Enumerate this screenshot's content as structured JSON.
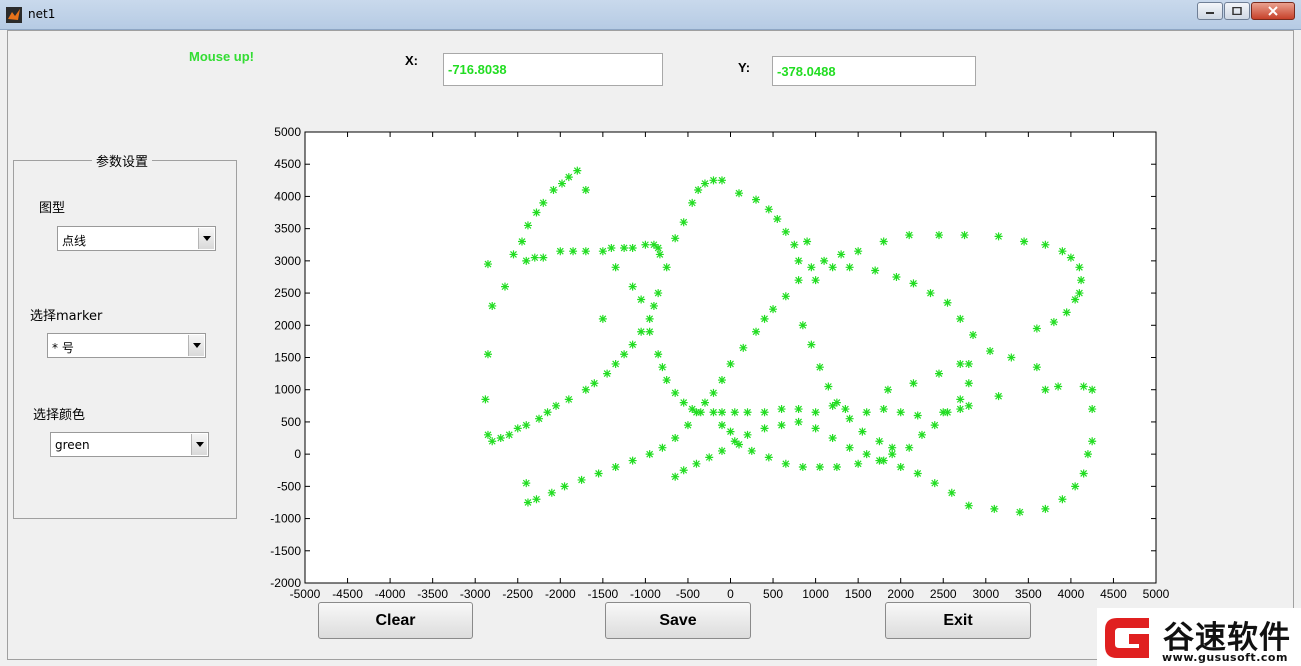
{
  "window": {
    "title": "net1"
  },
  "status_text": "Mouse up!",
  "coords": {
    "x_label": "X:",
    "x_value": "-716.8038",
    "y_label": "Y:",
    "y_value": "-378.0488"
  },
  "panel": {
    "title": "参数设置",
    "plot_type_label": "图型",
    "plot_type_value": "点线",
    "marker_label": "选择marker",
    "marker_value": "* 号",
    "color_label": "选择颜色",
    "color_value": "green"
  },
  "buttons": {
    "clear": "Clear",
    "save": "Save",
    "exit": "Exit"
  },
  "watermark": {
    "name": "谷速软件",
    "url": "www.gususoft.com"
  },
  "colors": {
    "marker": "#22dd22",
    "status": "#33dd33",
    "logo_red": "#e02020"
  },
  "chart_data": {
    "type": "scatter",
    "xlim": [
      -5000,
      5000
    ],
    "ylim": [
      -2000,
      5000
    ],
    "xticks": [
      -5000,
      -4500,
      -4000,
      -3500,
      -3000,
      -2500,
      -2000,
      -1500,
      -1000,
      -500,
      0,
      500,
      1000,
      1500,
      2000,
      2500,
      3000,
      3500,
      4000,
      4500,
      5000
    ],
    "yticks": [
      -2000,
      -1500,
      -1000,
      -500,
      0,
      500,
      1000,
      1500,
      2000,
      2500,
      3000,
      3500,
      4000,
      4500,
      5000
    ],
    "grid": false,
    "marker": "*",
    "marker_color": "#22dd22",
    "strokes": [
      [
        [
          -2850,
          2950
        ],
        [
          -2800,
          2300
        ],
        [
          -2650,
          2600
        ],
        [
          -2550,
          3100
        ],
        [
          -2450,
          3300
        ],
        [
          -2380,
          3550
        ],
        [
          -2280,
          3750
        ],
        [
          -2200,
          3900
        ],
        [
          -2080,
          4100
        ],
        [
          -1980,
          4200
        ],
        [
          -1900,
          4300
        ],
        [
          -1800,
          4400
        ],
        [
          -1700,
          4100
        ]
      ],
      [
        [
          -2400,
          3000
        ],
        [
          -2300,
          3050
        ],
        [
          -2200,
          3050
        ],
        [
          -2000,
          3150
        ],
        [
          -1850,
          3150
        ],
        [
          -1700,
          3150
        ],
        [
          -1500,
          3150
        ],
        [
          -1400,
          3200
        ],
        [
          -1250,
          3200
        ],
        [
          -1150,
          3200
        ],
        [
          -1000,
          3250
        ],
        [
          -900,
          3250
        ],
        [
          -850,
          3200
        ],
        [
          -830,
          3100
        ]
      ],
      [
        [
          -2850,
          1550
        ],
        [
          -2880,
          850
        ],
        [
          -2850,
          300
        ],
        [
          -2800,
          200
        ],
        [
          -2700,
          250
        ],
        [
          -2600,
          300
        ],
        [
          -2500,
          400
        ],
        [
          -2400,
          450
        ],
        [
          -2250,
          550
        ],
        [
          -2150,
          650
        ],
        [
          -2050,
          750
        ],
        [
          -1900,
          850
        ],
        [
          -1700,
          1000
        ],
        [
          -1600,
          1100
        ],
        [
          -1450,
          1250
        ],
        [
          -1350,
          1400
        ],
        [
          -1250,
          1550
        ],
        [
          -1150,
          1700
        ],
        [
          -1050,
          1900
        ],
        [
          -950,
          2100
        ],
        [
          -900,
          2300
        ],
        [
          -850,
          2500
        ],
        [
          -750,
          2900
        ],
        [
          -650,
          3350
        ],
        [
          -550,
          3600
        ],
        [
          -450,
          3900
        ],
        [
          -380,
          4100
        ],
        [
          -300,
          4200
        ],
        [
          -200,
          4250
        ],
        [
          -100,
          4250
        ],
        [
          100,
          4050
        ],
        [
          300,
          3950
        ],
        [
          450,
          3800
        ],
        [
          550,
          3650
        ],
        [
          650,
          3450
        ],
        [
          750,
          3250
        ],
        [
          800,
          3000
        ]
      ],
      [
        [
          -1500,
          2100
        ],
        [
          -1350,
          2900
        ],
        [
          -1150,
          2600
        ],
        [
          -1050,
          2400
        ],
        [
          -950,
          1900
        ],
        [
          -850,
          1550
        ],
        [
          -800,
          1350
        ],
        [
          -750,
          1150
        ],
        [
          -650,
          950
        ],
        [
          -550,
          800
        ],
        [
          -450,
          700
        ],
        [
          -350,
          650
        ],
        [
          -200,
          650
        ],
        [
          -100,
          650
        ],
        [
          50,
          650
        ],
        [
          200,
          650
        ],
        [
          400,
          650
        ],
        [
          600,
          700
        ],
        [
          800,
          700
        ],
        [
          1000,
          650
        ],
        [
          1200,
          750
        ],
        [
          1350,
          700
        ],
        [
          1600,
          650
        ],
        [
          1800,
          700
        ],
        [
          2000,
          650
        ],
        [
          2200,
          600
        ],
        [
          2500,
          650
        ],
        [
          2700,
          700
        ],
        [
          2800,
          750
        ]
      ],
      [
        [
          -2400,
          -450
        ],
        [
          -2380,
          -750
        ],
        [
          -2280,
          -700
        ],
        [
          -2100,
          -600
        ],
        [
          -1950,
          -500
        ],
        [
          -1750,
          -400
        ],
        [
          -1550,
          -300
        ],
        [
          -1350,
          -200
        ],
        [
          -1150,
          -100
        ],
        [
          -950,
          0
        ],
        [
          -800,
          100
        ],
        [
          -650,
          250
        ],
        [
          -500,
          450
        ],
        [
          -400,
          650
        ],
        [
          -300,
          800
        ],
        [
          -200,
          950
        ],
        [
          -100,
          1150
        ],
        [
          0,
          1400
        ],
        [
          150,
          1650
        ],
        [
          300,
          1900
        ],
        [
          400,
          2100
        ],
        [
          500,
          2250
        ],
        [
          650,
          2450
        ],
        [
          800,
          2700
        ],
        [
          950,
          2900
        ],
        [
          1100,
          3000
        ],
        [
          1300,
          3100
        ],
        [
          1500,
          3150
        ],
        [
          1800,
          3300
        ],
        [
          2100,
          3400
        ],
        [
          2450,
          3400
        ],
        [
          2750,
          3400
        ],
        [
          3150,
          3380
        ],
        [
          3450,
          3300
        ],
        [
          3700,
          3250
        ],
        [
          3900,
          3150
        ],
        [
          4000,
          3050
        ],
        [
          4100,
          2900
        ],
        [
          4120,
          2700
        ],
        [
          4100,
          2500
        ],
        [
          4050,
          2400
        ],
        [
          3950,
          2200
        ],
        [
          3800,
          2050
        ],
        [
          3600,
          1950
        ]
      ],
      [
        [
          -650,
          -350
        ],
        [
          -550,
          -250
        ],
        [
          -400,
          -150
        ],
        [
          -250,
          -50
        ],
        [
          -100,
          50
        ],
        [
          50,
          200
        ],
        [
          200,
          300
        ],
        [
          400,
          400
        ],
        [
          600,
          450
        ],
        [
          800,
          500
        ],
        [
          1000,
          400
        ],
        [
          1200,
          250
        ],
        [
          1400,
          100
        ],
        [
          1600,
          0
        ],
        [
          1800,
          -100
        ],
        [
          2000,
          -200
        ],
        [
          2200,
          -300
        ],
        [
          2400,
          -450
        ],
        [
          2600,
          -600
        ],
        [
          2800,
          -800
        ],
        [
          3100,
          -850
        ],
        [
          3400,
          -900
        ],
        [
          3700,
          -850
        ],
        [
          3900,
          -700
        ],
        [
          4050,
          -500
        ],
        [
          4150,
          -300
        ],
        [
          4200,
          0
        ],
        [
          4250,
          200
        ],
        [
          4250,
          700
        ],
        [
          4250,
          1000
        ],
        [
          4150,
          1050
        ],
        [
          3850,
          1050
        ],
        [
          3700,
          1000
        ]
      ],
      [
        [
          -100,
          450
        ],
        [
          0,
          350
        ],
        [
          100,
          150
        ],
        [
          250,
          50
        ],
        [
          450,
          -50
        ],
        [
          650,
          -150
        ],
        [
          850,
          -200
        ],
        [
          1050,
          -200
        ],
        [
          1250,
          -200
        ],
        [
          1500,
          -150
        ],
        [
          1750,
          -100
        ],
        [
          1900,
          0
        ],
        [
          2100,
          100
        ],
        [
          2250,
          300
        ],
        [
          2400,
          450
        ],
        [
          2550,
          650
        ],
        [
          2700,
          850
        ],
        [
          2800,
          1100
        ],
        [
          2800,
          1400
        ]
      ],
      [
        [
          900,
          3300
        ],
        [
          850,
          2000
        ],
        [
          950,
          1700
        ],
        [
          1050,
          1350
        ],
        [
          1150,
          1050
        ],
        [
          1250,
          800
        ],
        [
          1400,
          550
        ],
        [
          1550,
          350
        ],
        [
          1750,
          200
        ],
        [
          1900,
          100
        ]
      ],
      [
        [
          1000,
          2700
        ],
        [
          1200,
          2900
        ],
        [
          1400,
          2900
        ],
        [
          1700,
          2850
        ],
        [
          1950,
          2750
        ],
        [
          2150,
          2650
        ],
        [
          2350,
          2500
        ],
        [
          2550,
          2350
        ],
        [
          2700,
          2100
        ],
        [
          2850,
          1850
        ],
        [
          3050,
          1600
        ],
        [
          3300,
          1500
        ],
        [
          3600,
          1350
        ]
      ],
      [
        [
          1850,
          1000
        ],
        [
          2150,
          1100
        ],
        [
          2450,
          1250
        ],
        [
          2700,
          1400
        ],
        [
          3150,
          900
        ]
      ]
    ]
  }
}
